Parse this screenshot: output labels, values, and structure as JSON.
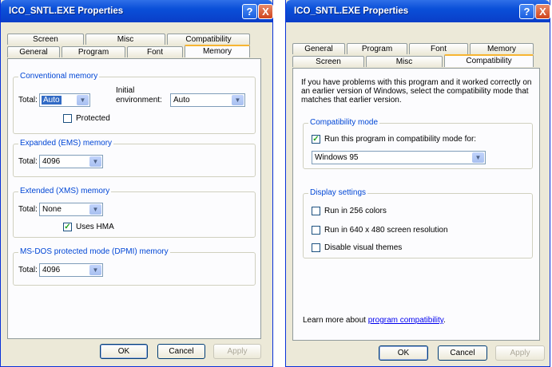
{
  "left": {
    "title": "ICO_SNTL.EXE Properties",
    "help": "?",
    "close": "X",
    "tabs_back": [
      "Screen",
      "Misc",
      "Compatibility"
    ],
    "tabs_front": [
      "General",
      "Program",
      "Font",
      "Memory"
    ],
    "conventional": {
      "label": "Conventional memory",
      "total_label": "Total:",
      "total_value": "Auto",
      "initial_label_1": "Initial",
      "initial_label_2": "environment:",
      "initial_value": "Auto",
      "protected_label": "Protected"
    },
    "expanded": {
      "label": "Expanded (EMS) memory",
      "total_label": "Total:",
      "total_value": "4096"
    },
    "extended": {
      "label": "Extended (XMS) memory",
      "total_label": "Total:",
      "total_value": "None",
      "hma_label": "Uses HMA"
    },
    "dpmi": {
      "label": "MS-DOS protected mode (DPMI) memory",
      "total_label": "Total:",
      "total_value": "4096"
    },
    "buttons": {
      "ok": "OK",
      "cancel": "Cancel",
      "apply": "Apply"
    }
  },
  "right": {
    "title": "ICO_SNTL.EXE Properties",
    "help": "?",
    "close": "X",
    "tabs_back": [
      "General",
      "Program",
      "Font",
      "Memory"
    ],
    "tabs_front": [
      "Screen",
      "Misc",
      "Compatibility"
    ],
    "intro": [
      "If you have problems with this program and it worked correctly on",
      "an earlier version of Windows, select the compatibility mode that",
      "matches that earlier version."
    ],
    "compat": {
      "label": "Compatibility mode",
      "run_label": "Run this program in compatibility mode for:",
      "os_value": "Windows 95"
    },
    "display": {
      "label": "Display settings",
      "colors_label": "Run in 256 colors",
      "res_label": "Run in 640 x 480 screen resolution",
      "themes_label": "Disable visual themes"
    },
    "learn_prefix": "Learn more about",
    "learn_link": "program compatibility",
    "learn_suffix": ".",
    "buttons": {
      "ok": "OK",
      "cancel": "Cancel",
      "apply": "Apply"
    }
  },
  "colors": {
    "titlebar": "#0a4fd8",
    "group_label": "#0046d5",
    "tab_accent": "#f7b532"
  }
}
